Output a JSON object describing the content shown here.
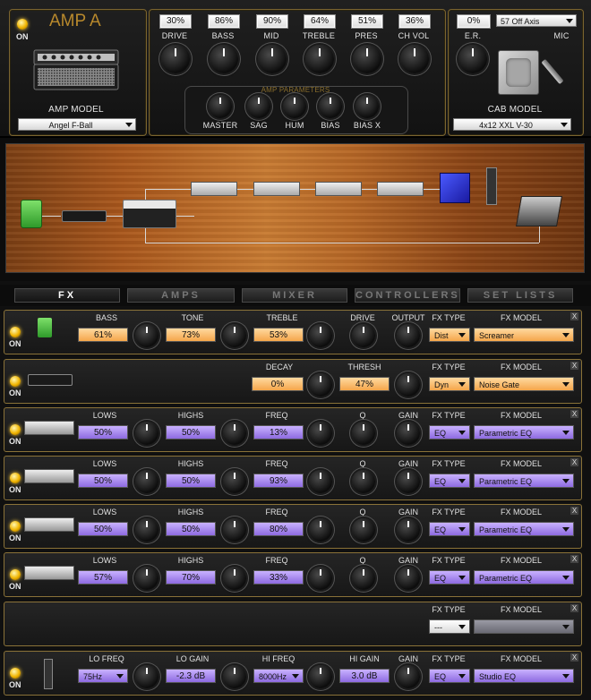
{
  "amp": {
    "power": "ON",
    "name": "AMP A",
    "model_label": "AMP MODEL",
    "model": "Angel F-Ball",
    "knobs": [
      {
        "label": "DRIVE",
        "value": "30%"
      },
      {
        "label": "BASS",
        "value": "86%"
      },
      {
        "label": "MID",
        "value": "90%"
      },
      {
        "label": "TREBLE",
        "value": "64%"
      },
      {
        "label": "PRES",
        "value": "51%"
      },
      {
        "label": "CH VOL",
        "value": "36%"
      }
    ],
    "params_title": "AMP PARAMETERS",
    "params": [
      "MASTER",
      "SAG",
      "HUM",
      "BIAS",
      "BIAS X"
    ],
    "er_label": "E.R.",
    "er_value": "0%",
    "mic_position": "57 Off Axis",
    "mic_label": "MIC",
    "cab_label": "CAB MODEL",
    "cab_model": "4x12 XXL V-30"
  },
  "tabs": [
    "FX",
    "AMPS",
    "MIXER",
    "CONTROLLERS",
    "SET LISTS"
  ],
  "fx_type_label": "FX TYPE",
  "fx_model_label": "FX MODEL",
  "close": "X",
  "rows": [
    {
      "on": "ON",
      "p": [
        {
          "l": "BASS",
          "v": "61%"
        },
        {
          "l": "TONE",
          "v": "73%"
        },
        {
          "l": "TREBLE",
          "v": "53%"
        }
      ],
      "k": [
        "DRIVE",
        "OUTPUT"
      ],
      "type": "Dist",
      "model": "Screamer"
    },
    {
      "on": "ON",
      "p": [
        {
          "l": "DECAY",
          "v": "0%"
        },
        {
          "l": "THRESH",
          "v": "47%"
        }
      ],
      "type": "Dyn",
      "model": "Noise Gate"
    },
    {
      "on": "ON",
      "p": [
        {
          "l": "LOWS",
          "v": "50%"
        },
        {
          "l": "HIGHS",
          "v": "50%"
        },
        {
          "l": "FREQ",
          "v": "13%"
        }
      ],
      "k": [
        "Q",
        "GAIN"
      ],
      "type": "EQ",
      "model": "Parametric EQ"
    },
    {
      "on": "ON",
      "p": [
        {
          "l": "LOWS",
          "v": "50%"
        },
        {
          "l": "HIGHS",
          "v": "50%"
        },
        {
          "l": "FREQ",
          "v": "93%"
        }
      ],
      "k": [
        "Q",
        "GAIN"
      ],
      "type": "EQ",
      "model": "Parametric EQ"
    },
    {
      "on": "ON",
      "p": [
        {
          "l": "LOWS",
          "v": "50%"
        },
        {
          "l": "HIGHS",
          "v": "50%"
        },
        {
          "l": "FREQ",
          "v": "80%"
        }
      ],
      "k": [
        "Q",
        "GAIN"
      ],
      "type": "EQ",
      "model": "Parametric EQ"
    },
    {
      "on": "ON",
      "p": [
        {
          "l": "LOWS",
          "v": "57%"
        },
        {
          "l": "HIGHS",
          "v": "70%"
        },
        {
          "l": "FREQ",
          "v": "33%"
        }
      ],
      "k": [
        "Q",
        "GAIN"
      ],
      "type": "EQ",
      "model": "Parametric EQ"
    },
    {
      "type": "---",
      "model": ""
    },
    {
      "on": "ON",
      "p": [
        {
          "l": "LO FREQ",
          "v": "75Hz"
        },
        {
          "l": "LO GAIN",
          "v": "-2.3 dB"
        },
        {
          "l": "HI FREQ",
          "v": "8000Hz"
        },
        {
          "l": "HI GAIN",
          "v": "3.0 dB"
        }
      ],
      "k": [
        "GAIN"
      ],
      "type": "EQ",
      "model": "Studio EQ"
    }
  ]
}
